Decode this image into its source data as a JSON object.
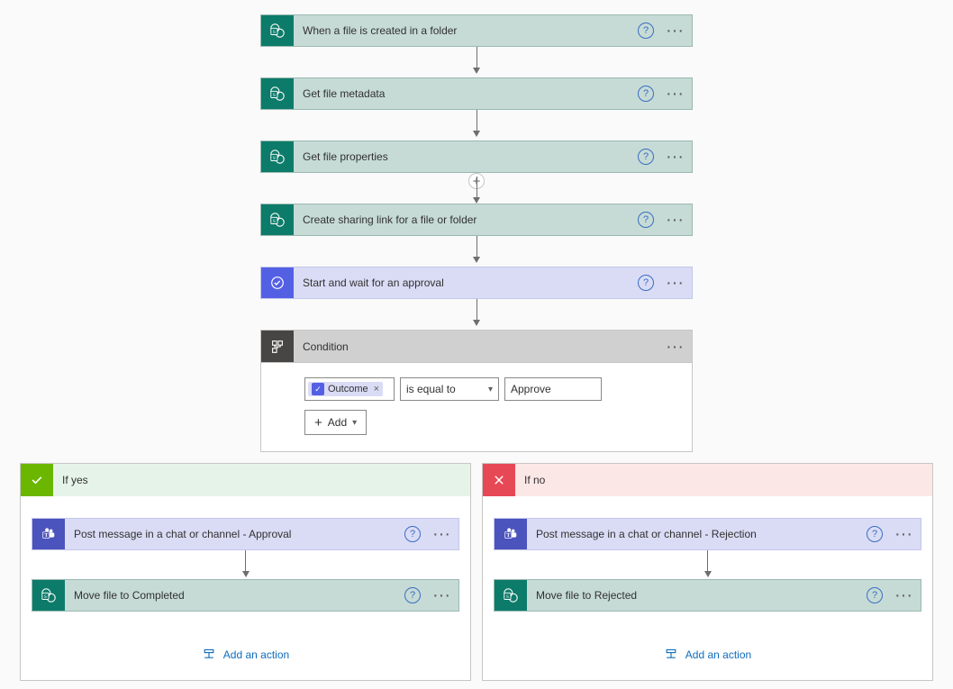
{
  "colors": {
    "sharepoint": "#0d7b6a",
    "approval": "#5460e4",
    "teams": "#4b53bc",
    "condition": "#484644",
    "link": "#0f6cbd"
  },
  "flow": {
    "steps": [
      {
        "id": "trigger",
        "label": "When a file is created in a folder",
        "connector": "sharepoint"
      },
      {
        "id": "metadata",
        "label": "Get file metadata",
        "connector": "sharepoint"
      },
      {
        "id": "props",
        "label": "Get file properties",
        "connector": "sharepoint"
      },
      {
        "id": "share",
        "label": "Create sharing link for a file or folder",
        "connector": "sharepoint"
      },
      {
        "id": "approval",
        "label": "Start and wait for an approval",
        "connector": "approval"
      }
    ],
    "condition": {
      "title": "Condition",
      "rows": [
        {
          "left_token": "Outcome",
          "operator": "is equal to",
          "right_value": "Approve"
        }
      ],
      "add_label": "Add"
    },
    "branches": {
      "yes": {
        "label": "If yes",
        "steps": [
          {
            "id": "post_yes",
            "label": "Post message in a chat or channel - Approval",
            "connector": "teams"
          },
          {
            "id": "move_yes",
            "label": "Move file to Completed",
            "connector": "sharepoint"
          }
        ],
        "add_action_label": "Add an action"
      },
      "no": {
        "label": "If no",
        "steps": [
          {
            "id": "post_no",
            "label": "Post message in a chat or channel - Rejection",
            "connector": "teams"
          },
          {
            "id": "move_no",
            "label": "Move file to Rejected",
            "connector": "sharepoint"
          }
        ],
        "add_action_label": "Add an action"
      }
    }
  },
  "icons": {
    "sharepoint": "sharepoint-icon",
    "approval": "approval-icon",
    "teams": "teams-icon",
    "condition": "condition-icon"
  }
}
